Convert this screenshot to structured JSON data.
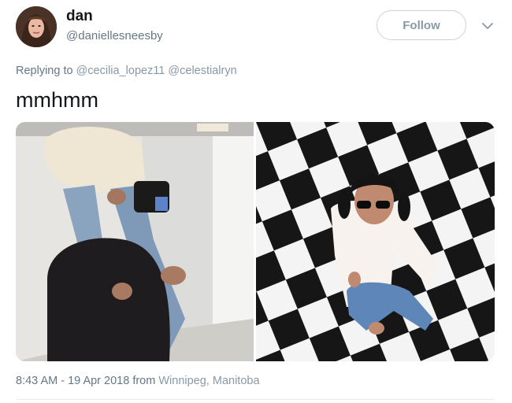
{
  "user": {
    "name": "dan",
    "handle": "@daniellesneesby"
  },
  "follow_button": {
    "label": "Follow"
  },
  "menu": {
    "icon": "chevron-down-icon"
  },
  "reply": {
    "prefix": "Replying to",
    "mentions": [
      "@cecilia_lopez11",
      "@celestialryn"
    ]
  },
  "tweet": {
    "text": "mmhmm"
  },
  "media": [
    {
      "icon": "photo-left"
    },
    {
      "icon": "photo-right"
    }
  ],
  "meta": {
    "timestamp": "8:43 AM - 19 Apr 2018",
    "from": "from",
    "location": "Winnipeg, Manitoba"
  },
  "colors": {
    "text": "#14171a",
    "muted": "#657786",
    "link_muted": "#8899a6",
    "button_border": "#c9d3da"
  }
}
